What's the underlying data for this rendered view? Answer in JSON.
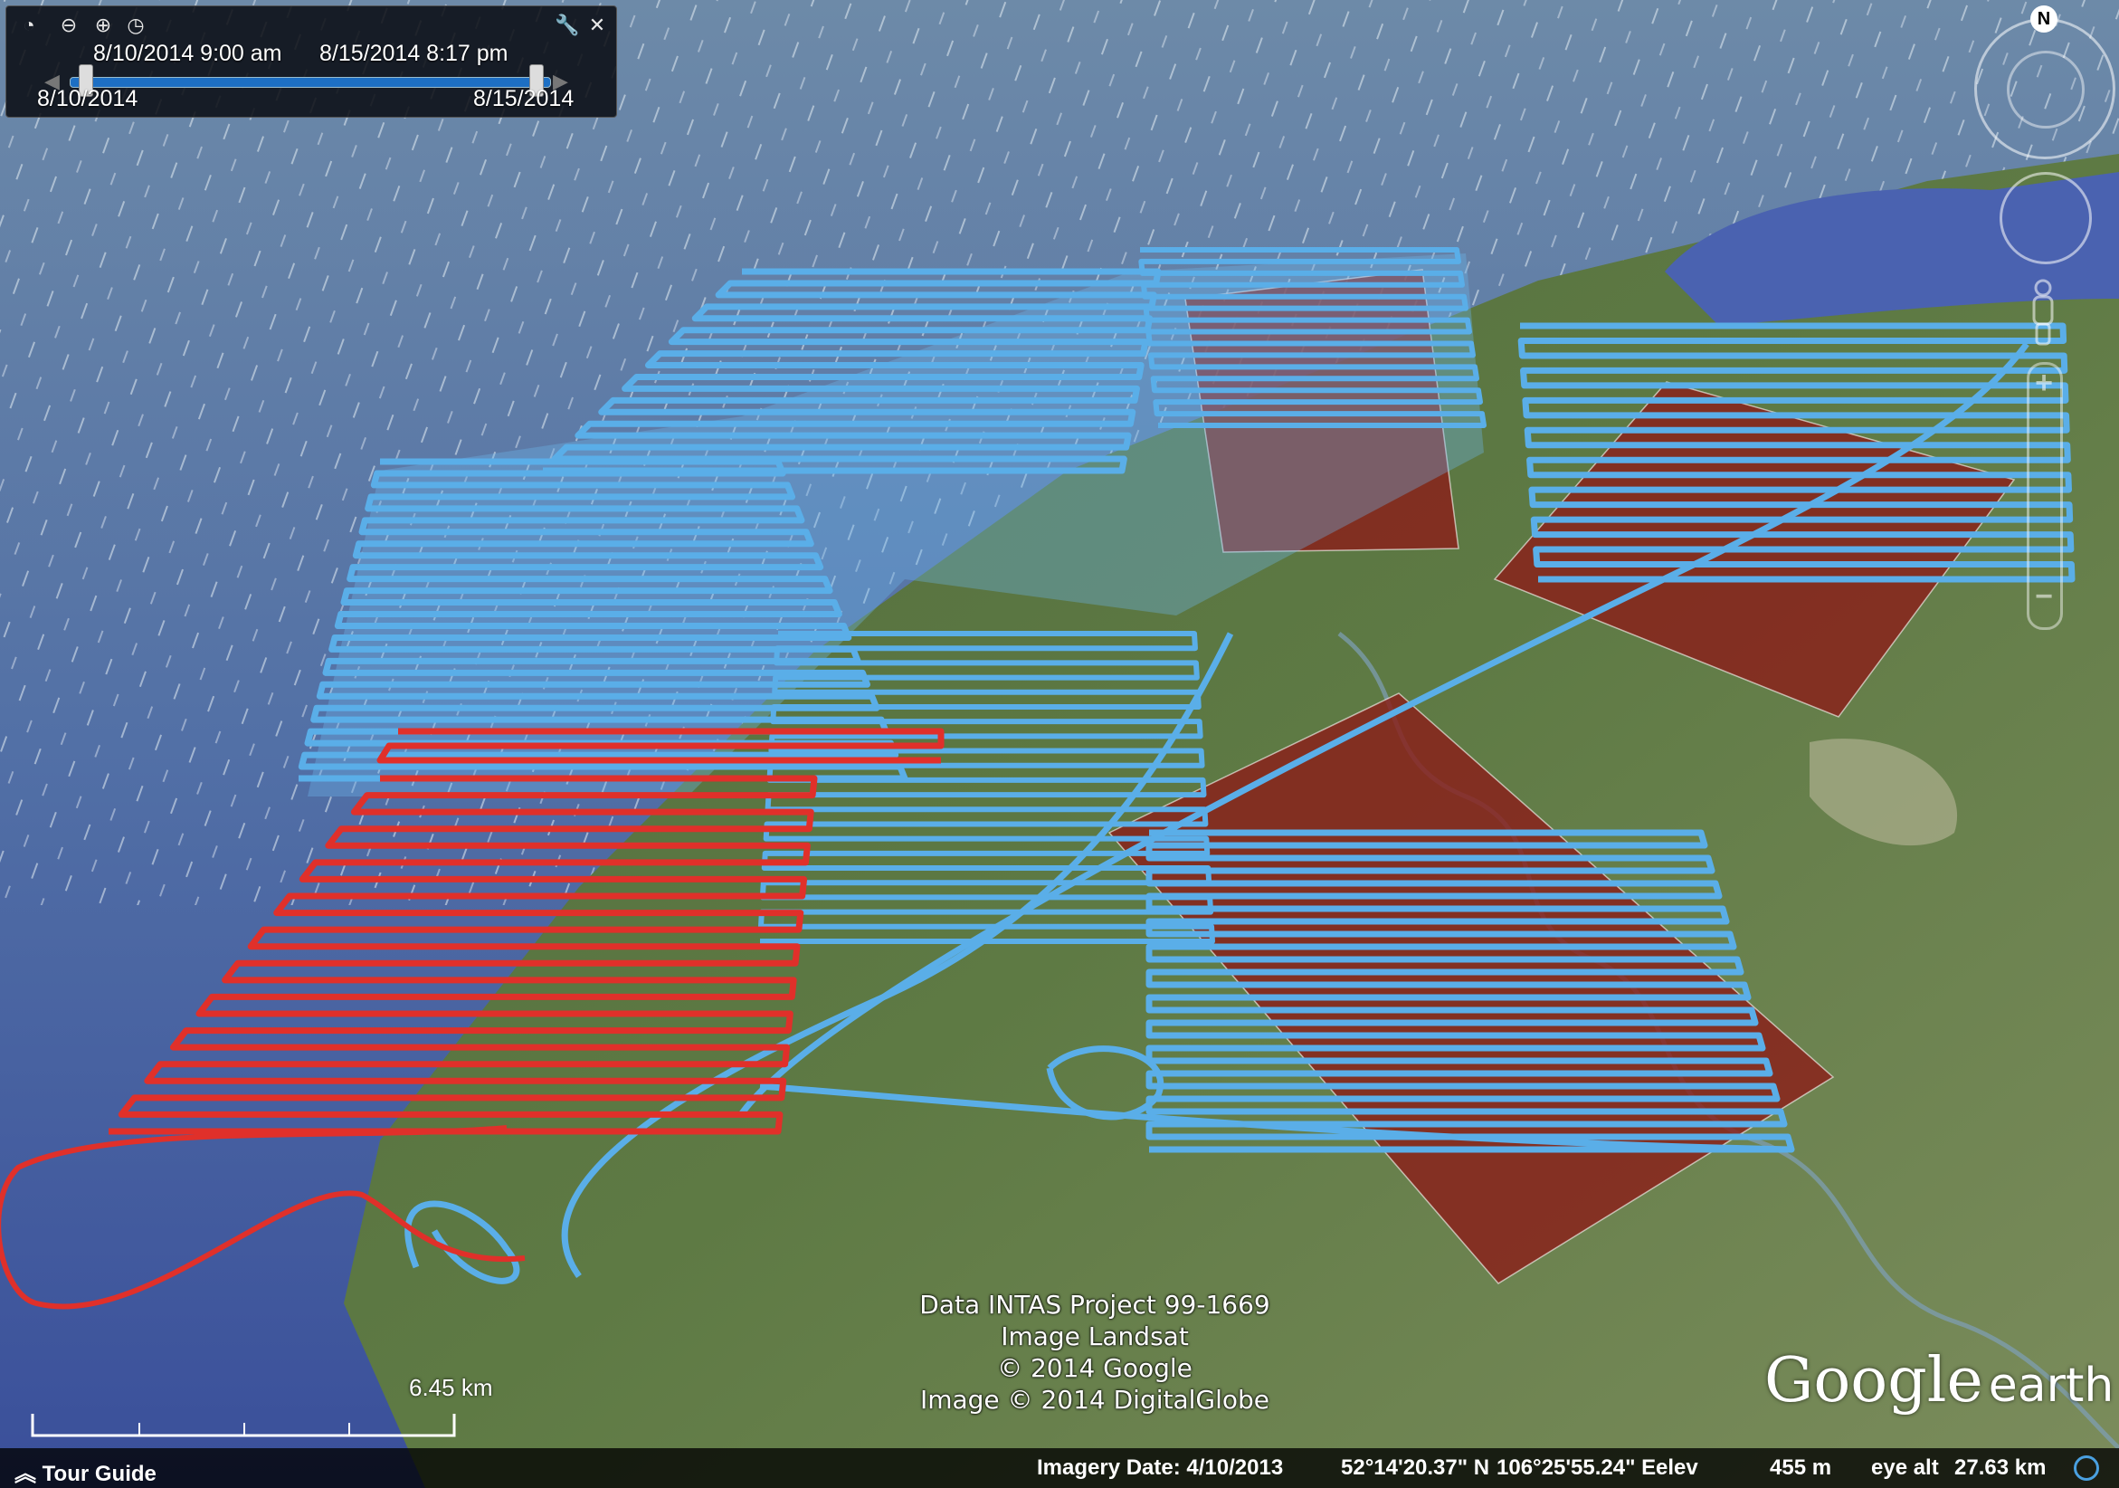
{
  "time_slider": {
    "clock_icon": "clock-icon",
    "zoom_out_icon": "zoom-out-icon",
    "zoom_in_icon": "zoom-in-icon",
    "settings_icon": "wrench-icon",
    "close_icon": "close-icon",
    "animate_icon": "animate-clock-icon",
    "start_datetime": "8/10/2014   9:00 am",
    "end_datetime": "8/15/2014   8:17 pm",
    "range_start": "8/10/2014",
    "range_end": "8/15/2014"
  },
  "navigation": {
    "north_label": "N"
  },
  "attribution": {
    "line1": "Data INTAS Project 99-1669",
    "line2": "Image Landsat",
    "line3": "© 2014 Google",
    "line4": "Image © 2014 DigitalGlobe"
  },
  "logo": {
    "google": "Google",
    "earth": "earth"
  },
  "scale": {
    "label": "6.45 km"
  },
  "status_bar": {
    "tour_guide": "Tour Guide",
    "imagery_date": "Imagery Date: 4/10/2013",
    "latitude": "52°14'20.37\" N",
    "longitude": "106°25'55.24\" E",
    "elev_label": "elev",
    "elev_value": "455 m",
    "eye_alt_label": "eye alt",
    "eye_alt_value": "27.63 km"
  },
  "colors": {
    "water": "#3a5a9a",
    "land": "#4e6a3c",
    "blue_track": "#5aaee8",
    "red_track": "#e0302a",
    "red_polygon": "#8a1f1a"
  }
}
